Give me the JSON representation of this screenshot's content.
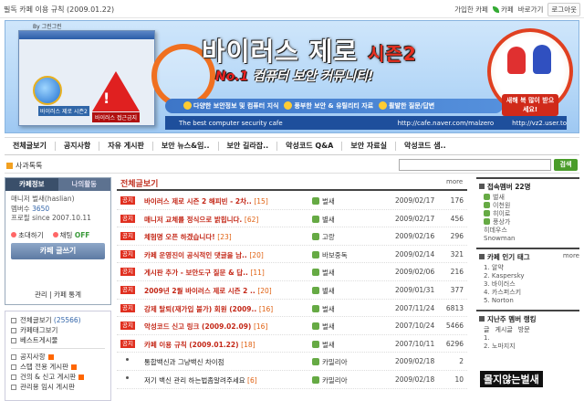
{
  "topbar": {
    "notice": "필독 카페 이용 규칙 (2009.01.22)",
    "join_cafe": "가입한 카페",
    "cafe_label": "카페",
    "shortcut": "바로가기",
    "login": "로그아웃"
  },
  "banner": {
    "corner_label": "By 그린그린",
    "title_main": "바이러스 제로",
    "title_season": "시즌2",
    "subtitle_no": "No.1",
    "subtitle_rest": " 컴퓨터 보안 커뮤니티!",
    "ie_label": "바이러스 제로 시즌2",
    "warn_label": "바이러스 접근금지",
    "strip_items": [
      "다양한 보안정보 및 컴퓨터 지식",
      "풍부한 보안 & 유틸리티 자료",
      "활발한 질문/답변"
    ],
    "site_label": "The best computer security cafe",
    "url1": "http://cafe.naver.com/malzero",
    "url2": "http://vz2.user.to",
    "badge_text": "새해 복 많이 받으세요!"
  },
  "nav": [
    "전체글보기",
    "공지사항",
    "자유 게시판",
    "보안 뉴스&임..",
    "보안 길라잡..",
    "악성코드 Q&A",
    "보안 자료실",
    "악성코드 샘.."
  ],
  "search": {
    "label": "사과톡톡",
    "placeholder": "",
    "button": "검색"
  },
  "left": {
    "tab_active": "카페정보",
    "tab_other": "나의활동",
    "manager_label": "매니저 ",
    "manager_name": "벌새(haslian)",
    "members_label": "멤버수 ",
    "members": "3650",
    "since": "프로필 since 2007.10.11",
    "invite": "초대하기",
    "chat": "채팅",
    "chat_status": "OFF",
    "write": "카페 글쓰기",
    "manage": "관리 | 카페 통계",
    "menu": [
      {
        "label": "전체글보기",
        "count": "(25566)"
      },
      {
        "label": "카페태그보기"
      },
      {
        "label": "베스트게시물"
      },
      {
        "sep": true
      },
      {
        "label": "공지사항",
        "new": true
      },
      {
        "label": "스탭 전용 게시판",
        "new": true
      },
      {
        "label": "건의 & 신고 게시판",
        "new": true
      },
      {
        "label": "관리용 임시 게시판"
      }
    ]
  },
  "main": {
    "heading": "전체글보기",
    "more": "more",
    "notice_tag": "공지",
    "rows": [
      {
        "notice": true,
        "subject": "바이러스 제로 시즌 2 해피빈 - 2차..",
        "count": "[15]",
        "writer": "벌새",
        "date": "2009/02/17",
        "hits": "176"
      },
      {
        "notice": true,
        "subject": "매니저 교체를 정식으로 밝힙니다.",
        "count": "[62]",
        "writer": "별새",
        "date": "2009/02/17",
        "hits": "456"
      },
      {
        "notice": true,
        "subject": "체험명 오픈 하겠습니다!",
        "count": "[23]",
        "writer": "고랑",
        "date": "2009/02/16",
        "hits": "296"
      },
      {
        "notice": true,
        "subject": "카페 운영진이 공식적인 댓글을 남..",
        "count": "[20]",
        "writer": "바보중독",
        "date": "2009/02/14",
        "hits": "321"
      },
      {
        "notice": true,
        "subject": "게시판 추가 - 보안도구 질문 & 답..",
        "count": "[11]",
        "writer": "벌새",
        "date": "2009/02/06",
        "hits": "216"
      },
      {
        "notice": true,
        "subject": "2009년 2월 바이러스 제로 시즌 2 ..",
        "count": "[20]",
        "writer": "별새",
        "date": "2009/01/31",
        "hits": "377"
      },
      {
        "notice": true,
        "subject": "강제 탈퇴(재가입 불가) 회원 (2009..",
        "count": "[16]",
        "writer": "벌새",
        "date": "2007/11/24",
        "hits": "6813"
      },
      {
        "notice": true,
        "subject": "악성코드 신고 링크 (2009.02.09)",
        "count": "[16]",
        "writer": "벌새",
        "date": "2007/10/24",
        "hits": "5466"
      },
      {
        "notice": true,
        "subject": "카페 이용 규칙 (2009.01.22)",
        "count": "[18]",
        "writer": "벌새",
        "date": "2007/10/11",
        "hits": "6296"
      },
      {
        "notice": false,
        "subject": "통합백신과 그냥백신 차이점",
        "count": "",
        "writer": "카밀리아",
        "date": "2009/02/18",
        "hits": "2"
      },
      {
        "notice": false,
        "subject": "저기 백신 관리 하는법좀알려주세요",
        "count": "[6]",
        "writer": "카밀리아",
        "date": "2009/02/18",
        "hits": "10"
      }
    ]
  },
  "right": {
    "members_title": "접속멤버 22명",
    "members": [
      "벌새",
      "이천원",
      "히이로",
      "풍상가",
      "히데우스",
      "Snowman"
    ],
    "popular_title": "카페 인기 태그",
    "popular_more": "more",
    "tags": [
      "1. 알약",
      "2. Kaspersky",
      "3. 바이러스",
      "4. 카스퍼스키",
      "5. Norton"
    ],
    "ranking_title": "지난주 멤버 랭킹",
    "ranking_tabs": [
      "글",
      "게시글",
      "방문"
    ],
    "ranking": [
      "1.",
      "2. 노마지지"
    ]
  },
  "tooltip": "몰지않는벌새"
}
